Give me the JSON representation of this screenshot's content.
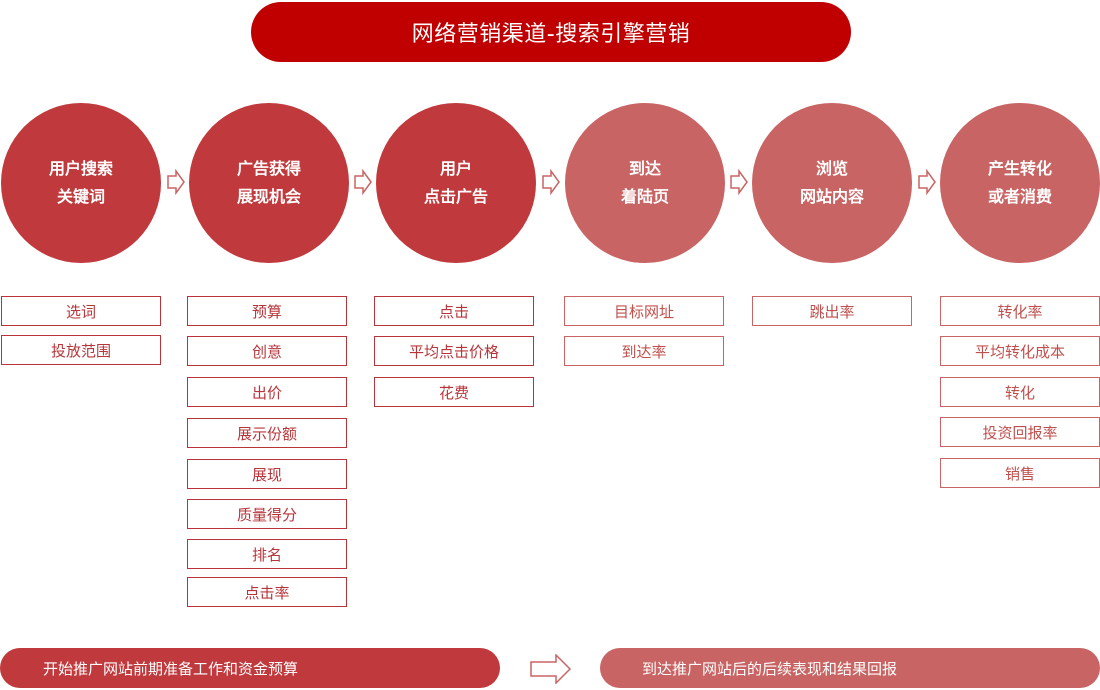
{
  "title": "网络营销渠道-搜索引擎营销",
  "stages": [
    {
      "line1": "用户搜索",
      "line2": "关键词",
      "tone": "dark",
      "metrics": [
        "选词",
        "投放范围"
      ]
    },
    {
      "line1": "广告获得",
      "line2": "展现机会",
      "tone": "dark",
      "metrics": [
        "预算",
        "创意",
        "出价",
        "展示份额",
        "展现",
        "质量得分",
        "排名",
        "点击率"
      ]
    },
    {
      "line1": "用户",
      "line2": "点击广告",
      "tone": "dark",
      "metrics": [
        "点击",
        "平均点击价格",
        "花费"
      ]
    },
    {
      "line1": "到达",
      "line2": "着陆页",
      "tone": "light",
      "metrics": [
        "目标网址",
        "到达率"
      ]
    },
    {
      "line1": "浏览",
      "line2": "网站内容",
      "tone": "light",
      "metrics": [
        "跳出率"
      ]
    },
    {
      "line1": "产生转化",
      "line2": "或者消费",
      "tone": "light",
      "metrics": [
        "转化率",
        "平均转化成本",
        "转化",
        "投资回报率",
        "销售"
      ]
    }
  ],
  "bottom": {
    "left": "开始推广网站前期准备工作和资金预算",
    "right": "到达推广网站后的后续表现和结果回报"
  },
  "colors": {
    "title": "#c00000",
    "dark": "#c0393c",
    "light": "#c86463",
    "border": "#b7353a"
  }
}
